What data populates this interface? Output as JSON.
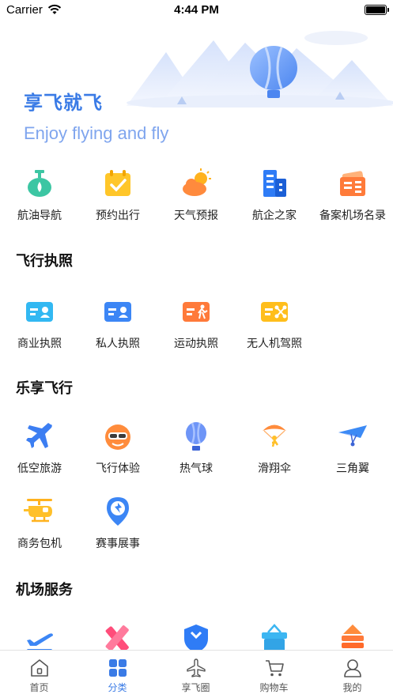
{
  "status_bar": {
    "carrier": "Carrier",
    "time": "4:44 PM"
  },
  "hero": {
    "title": "享飞就飞",
    "subtitle": "Enjoy flying and fly"
  },
  "quick_grid": [
    {
      "icon": "oil-drop-icon",
      "label": "航油导航"
    },
    {
      "icon": "calendar-check-icon",
      "label": "预约出行"
    },
    {
      "icon": "weather-cloud-sun-icon",
      "label": "天气预报"
    },
    {
      "icon": "building-icon",
      "label": "航企之家"
    },
    {
      "icon": "ticket-list-icon",
      "label": "备案机场名录"
    }
  ],
  "sections": {
    "license": {
      "title": "飞行执照",
      "items": [
        {
          "icon": "commercial-license-icon",
          "label": "商业执照"
        },
        {
          "icon": "private-license-icon",
          "label": "私人执照"
        },
        {
          "icon": "sport-license-icon",
          "label": "运动执照"
        },
        {
          "icon": "drone-license-icon",
          "label": "无人机驾照"
        }
      ]
    },
    "enjoy": {
      "title": "乐享飞行",
      "items": [
        {
          "icon": "airplane-icon",
          "label": "低空旅游"
        },
        {
          "icon": "pilot-helmet-icon",
          "label": "飞行体验"
        },
        {
          "icon": "hot-air-balloon-icon",
          "label": "热气球"
        },
        {
          "icon": "paraglider-icon",
          "label": "滑翔伞"
        },
        {
          "icon": "hang-glider-icon",
          "label": "三角翼"
        },
        {
          "icon": "helicopter-icon",
          "label": "商务包机"
        },
        {
          "icon": "event-pin-icon",
          "label": "赛事展事"
        }
      ]
    },
    "airport": {
      "title": "机场服务",
      "items": [
        {
          "icon": "takeoff-icon"
        },
        {
          "icon": "ruler-pencil-icon"
        },
        {
          "icon": "shield-wrench-icon"
        },
        {
          "icon": "shopping-basket-icon"
        },
        {
          "icon": "stack-icon"
        }
      ]
    }
  },
  "tab_bar": [
    {
      "icon": "home-icon",
      "label": "首页",
      "active": false
    },
    {
      "icon": "category-grid-icon",
      "label": "分类",
      "active": true
    },
    {
      "icon": "plane-outline-icon",
      "label": "享飞圈",
      "active": false
    },
    {
      "icon": "cart-icon",
      "label": "购物车",
      "active": false
    },
    {
      "icon": "user-icon",
      "label": "我的",
      "active": false
    }
  ],
  "colors": {
    "accent": "#3a7be6",
    "tab_inactive": "#555555"
  }
}
